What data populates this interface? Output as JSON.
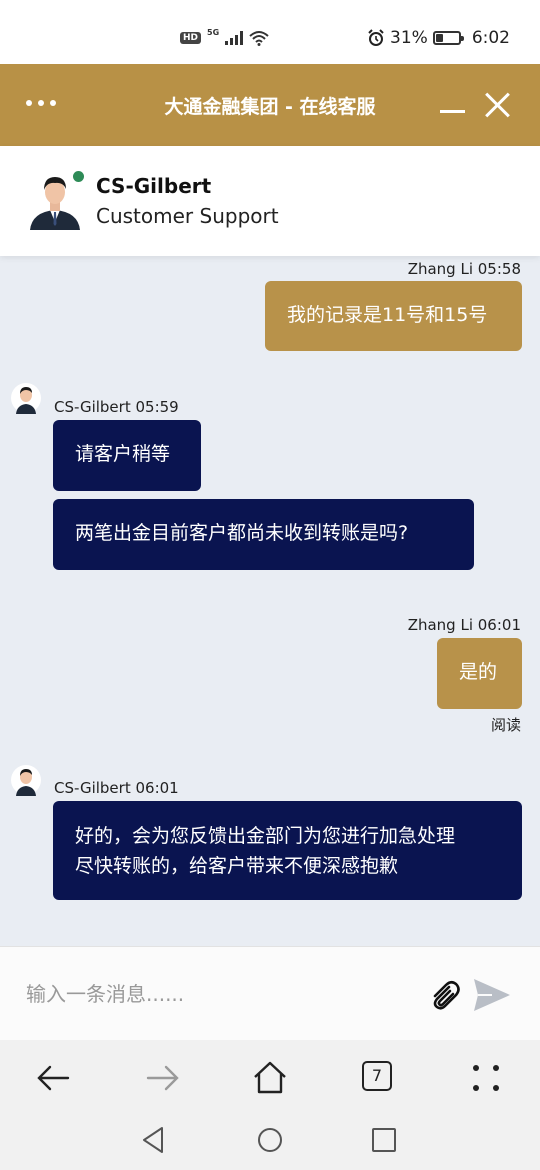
{
  "status_bar": {
    "hd": "HD",
    "network": "5G",
    "battery_level": 31,
    "battery_text": "31%",
    "time": "6:02"
  },
  "header": {
    "title": "大通金融集团 - 在线客服"
  },
  "agent": {
    "name": "CS-Gilbert",
    "role": "Customer Support",
    "online_color": "#2e8b57"
  },
  "messages": [
    {
      "sender": "Zhang Li 05:58",
      "text": "我的记录是11号和15号"
    },
    {
      "sender": "CS-Gilbert 05:59",
      "text": "请客户稍等"
    },
    {
      "text": "两笔出金目前客户都尚未收到转账是吗?"
    },
    {
      "sender": "Zhang Li 06:01",
      "text": "是的",
      "status": "阅读"
    },
    {
      "sender": "CS-Gilbert 06:01",
      "text_line1": "好的，会为您反馈出金部门为您进行加急处理",
      "text_line2": "尽快转账的，给客户带来不便深感抱歉"
    }
  ],
  "input": {
    "placeholder": "输入一条消息......"
  },
  "browser_nav": {
    "tab_count": "7"
  },
  "colors": {
    "brand_gold": "#b89146",
    "agent_bubble": "#0a1450",
    "chat_bg": "#e9edf3"
  },
  "icons": [
    "menu-dots-icon",
    "minimize-icon",
    "close-icon",
    "attachment-icon",
    "send-icon",
    "back-arrow-icon",
    "forward-arrow-icon",
    "home-icon",
    "more-icon"
  ]
}
